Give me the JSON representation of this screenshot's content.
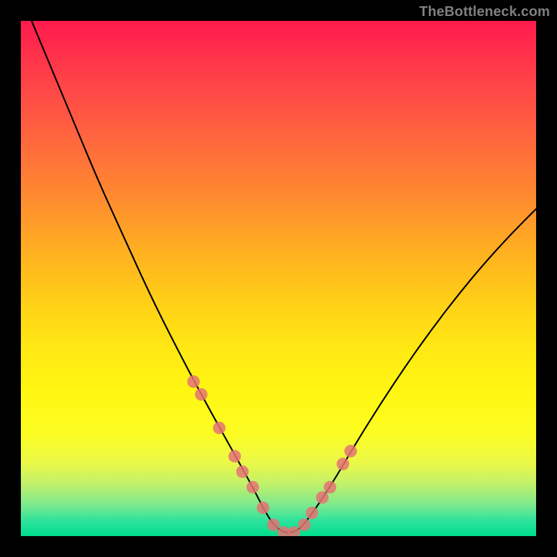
{
  "watermark": "TheBottleneck.com",
  "colors": {
    "page_bg": "#000000",
    "curve_stroke": "#000000",
    "dot_fill": "#e57373",
    "gradient_top": "#ff1a4d",
    "gradient_mid": "#ffe913",
    "gradient_bottom": "#00dd8e"
  },
  "chart_data": {
    "type": "line",
    "title": "",
    "xlabel": "",
    "ylabel": "",
    "xlim": [
      0,
      100
    ],
    "ylim": [
      0,
      100
    ],
    "grid": false,
    "legend": false,
    "series": [
      {
        "name": "bottleneck-curve",
        "x": [
          0,
          5,
          10,
          15,
          20,
          25,
          30,
          35,
          40,
          45,
          47,
          49,
          51,
          53,
          55,
          60,
          65,
          70,
          75,
          80,
          85,
          90,
          95,
          100
        ],
        "y": [
          105,
          93,
          81,
          69,
          58,
          47,
          37,
          27.5,
          18.5,
          9.5,
          5.5,
          2.2,
          0.7,
          0.7,
          2.2,
          9.5,
          18,
          26,
          33.5,
          40.5,
          47,
          53,
          58.5,
          63.5
        ]
      }
    ],
    "dots": {
      "name": "highlight-dots",
      "x": [
        33.5,
        35.0,
        38.5,
        41.5,
        43.0,
        45.0,
        47.0,
        49.0,
        51.0,
        53.0,
        55.0,
        56.5,
        58.5,
        60.0,
        62.5,
        64.0
      ],
      "y": [
        30.0,
        27.5,
        21.0,
        15.5,
        12.5,
        9.5,
        5.5,
        2.2,
        0.7,
        0.7,
        2.2,
        4.5,
        7.5,
        9.5,
        14.0,
        16.5
      ]
    }
  }
}
